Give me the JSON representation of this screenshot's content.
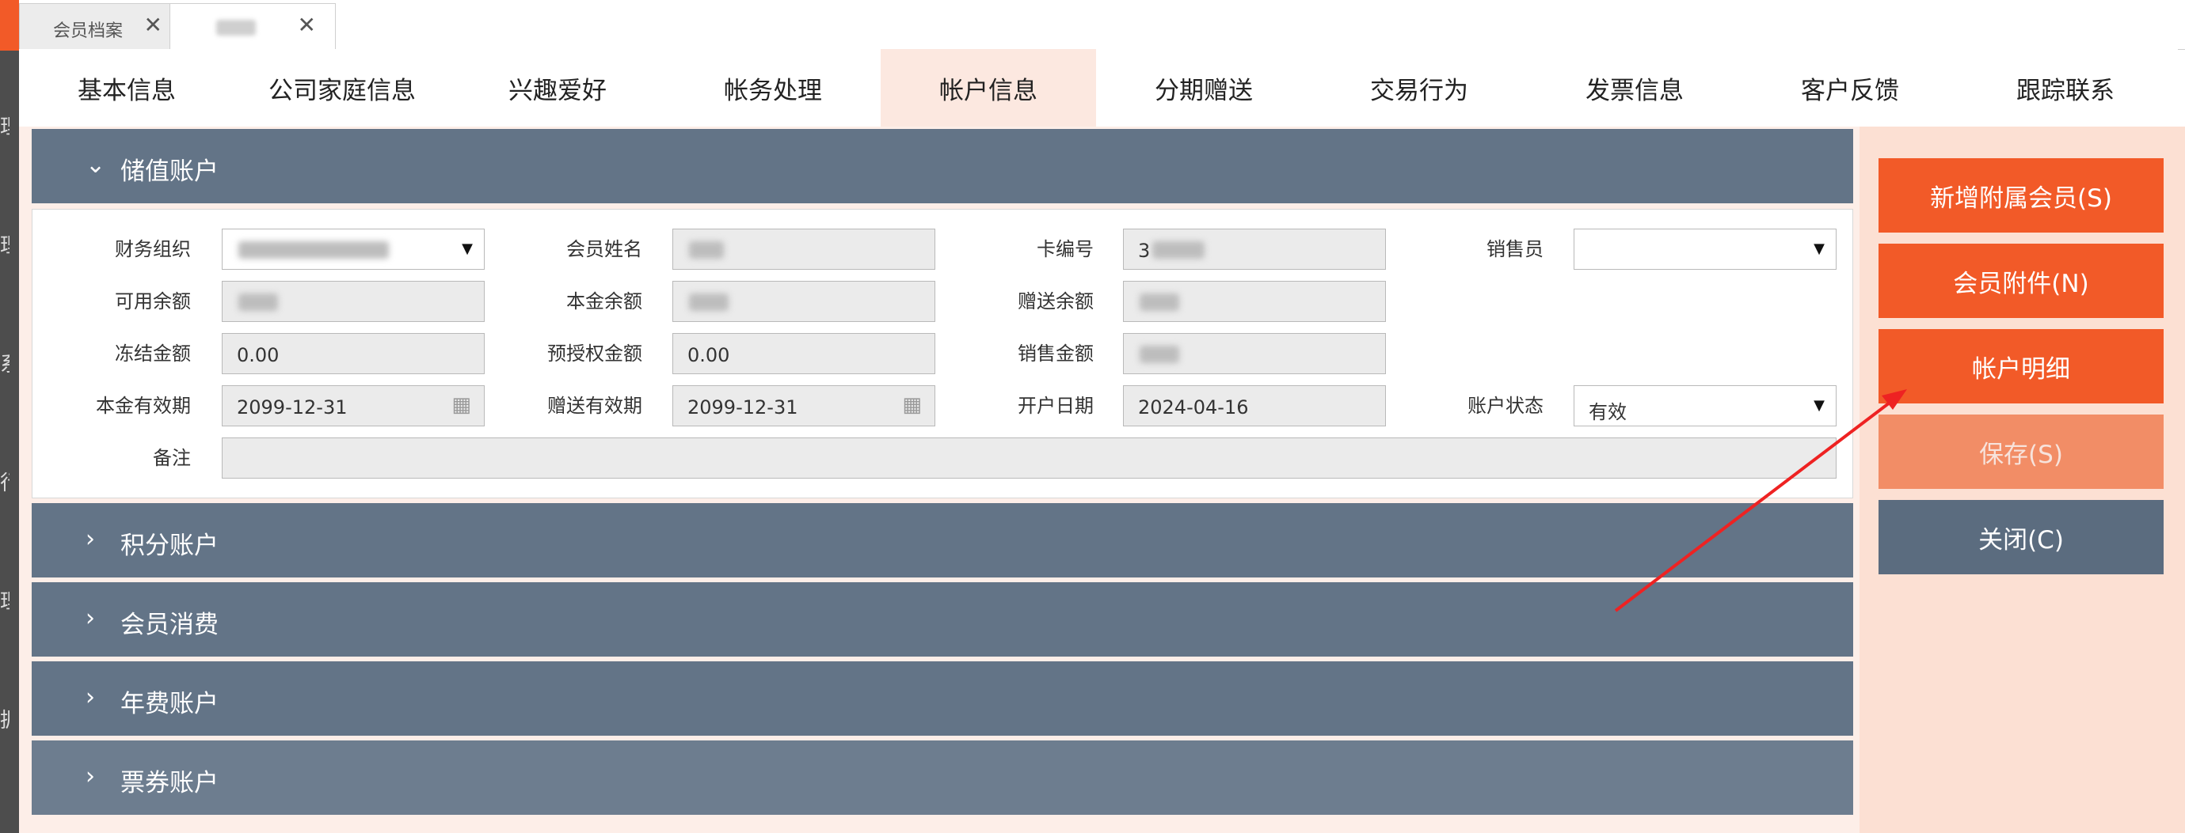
{
  "doc_tabs": [
    {
      "label": "会员档案",
      "close": "✕"
    },
    {
      "label": "",
      "close": "✕"
    }
  ],
  "nav_tabs": [
    {
      "label": "基本信息"
    },
    {
      "label": "公司家庭信息"
    },
    {
      "label": "兴趣爱好"
    },
    {
      "label": "帐务处理"
    },
    {
      "label": "帐户信息",
      "active": true
    },
    {
      "label": "分期赠送"
    },
    {
      "label": "交易行为"
    },
    {
      "label": "发票信息"
    },
    {
      "label": "客户反馈"
    },
    {
      "label": "跟踪联系"
    }
  ],
  "panels": {
    "stored": {
      "title": "储值账户",
      "chevron": "⌄"
    },
    "points": {
      "title": "积分账户",
      "chevron": "›"
    },
    "consumption": {
      "title": "会员消费",
      "chevron": "›"
    },
    "annual_fee": {
      "title": "年费账户",
      "chevron": "›"
    },
    "voucher": {
      "title": "票券账户",
      "chevron": "›"
    }
  },
  "form": {
    "finance_org": {
      "label": "财务组织",
      "value": ""
    },
    "member_name": {
      "label": "会员姓名",
      "value": ""
    },
    "card_no": {
      "label": "卡编号",
      "value": "3"
    },
    "salesperson": {
      "label": "销售员",
      "value": ""
    },
    "available_balance": {
      "label": "可用余额",
      "value": ""
    },
    "principal_balance": {
      "label": "本金余额",
      "value": ""
    },
    "bonus_balance": {
      "label": "赠送余额",
      "value": ""
    },
    "frozen_amount": {
      "label": "冻结金额",
      "value": "0.00"
    },
    "preauth_amount": {
      "label": "预授权金额",
      "value": "0.00"
    },
    "sales_amount": {
      "label": "销售金额",
      "value": ""
    },
    "principal_expiry": {
      "label": "本金有效期",
      "value": "2099-12-31"
    },
    "bonus_expiry": {
      "label": "赠送有效期",
      "value": "2099-12-31"
    },
    "open_date": {
      "label": "开户日期",
      "value": "2024-04-16"
    },
    "account_status": {
      "label": "账户状态",
      "value": "有效"
    },
    "remark": {
      "label": "备注",
      "value": ""
    }
  },
  "actions": {
    "add_member": "新增附属会员(S)",
    "attachments": "会员附件(N)",
    "account_detail": "帐户明细",
    "save": "保存(S)",
    "close": "关闭(C)"
  },
  "icons": {
    "dropdown": "▼",
    "calendar": "calendar-icon"
  },
  "colors": {
    "accent": "#f25a28",
    "panel": "#637487",
    "slate": "#5b6c7f",
    "annotation": "#ee2222"
  }
}
